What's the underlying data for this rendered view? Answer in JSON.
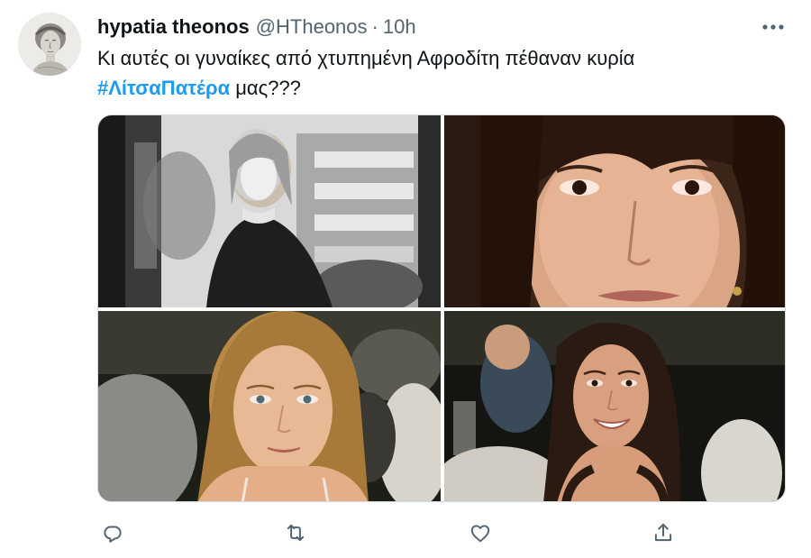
{
  "tweet": {
    "author": {
      "display_name": "hypatia theonos",
      "handle": "@HTheonos",
      "separator": "·",
      "time": "10h",
      "avatar_icon": "hypatia-portrait-avatar"
    },
    "text": {
      "line1": "Κι αυτές οι γυναίκες από χτυπημένη Αφροδίτη πέθαναν κυρία",
      "hashtag": "#ΛίτσαΠατέρα",
      "line2_rest": " μας???"
    },
    "media": {
      "photos": [
        {
          "icon": "black-white-woman-photo"
        },
        {
          "icon": "dark-hair-woman-closeup-photo"
        },
        {
          "icon": "blonde-woman-photo"
        },
        {
          "icon": "smiling-brunette-woman-photo"
        }
      ]
    },
    "actions": [
      {
        "icon": "reply-icon"
      },
      {
        "icon": "retweet-icon"
      },
      {
        "icon": "like-icon"
      },
      {
        "icon": "share-icon"
      }
    ]
  },
  "colors": {
    "text_primary": "#0f1419",
    "text_secondary": "#536471",
    "accent": "#1d9bf0",
    "border": "#cfd9de"
  }
}
